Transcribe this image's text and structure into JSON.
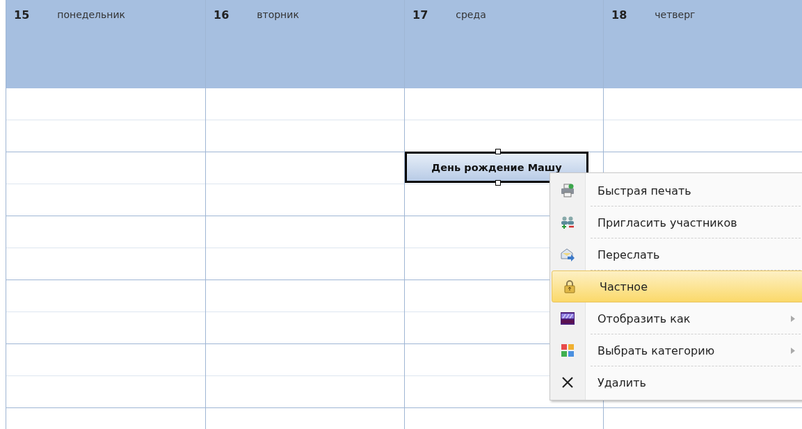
{
  "days": [
    {
      "number": "15",
      "name": "понедельник"
    },
    {
      "number": "16",
      "name": "вторник"
    },
    {
      "number": "17",
      "name": "среда",
      "events": [
        {
          "title": "День рождение Машу",
          "selected": true
        }
      ]
    },
    {
      "number": "18",
      "name": "четверг"
    }
  ],
  "context_menu": {
    "items": [
      {
        "kind": "print",
        "label": "Быстрая печать",
        "selected": false,
        "submenu": false
      },
      {
        "kind": "invite",
        "label": "Пригласить участников",
        "selected": false,
        "submenu": false
      },
      {
        "kind": "forward",
        "label": "Переслать",
        "selected": false,
        "submenu": false
      },
      {
        "kind": "private",
        "label": "Частное",
        "selected": true,
        "submenu": false
      },
      {
        "kind": "show-as",
        "label": "Отобразить как",
        "selected": false,
        "submenu": true
      },
      {
        "kind": "category",
        "label": "Выбрать категорию",
        "selected": false,
        "submenu": true
      },
      {
        "kind": "delete",
        "label": "Удалить",
        "selected": false,
        "submenu": false
      }
    ]
  }
}
